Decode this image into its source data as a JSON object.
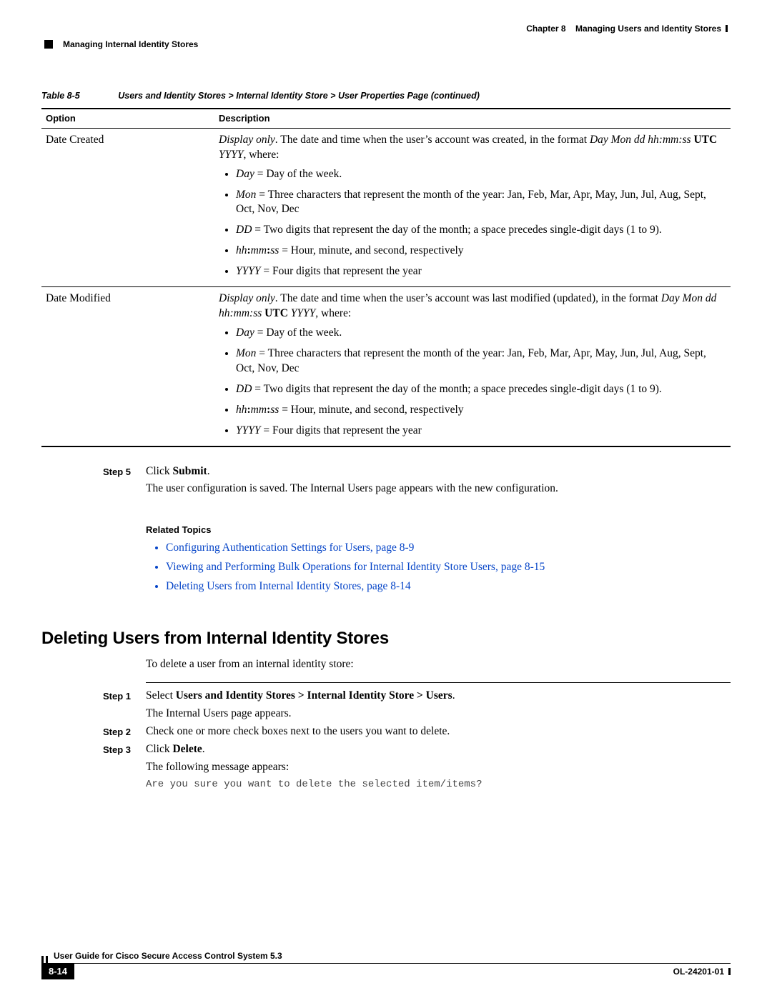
{
  "header": {
    "chapter_label": "Chapter 8",
    "chapter_title": "Managing Users and Identity Stores",
    "section_title": "Managing Internal Identity Stores"
  },
  "table": {
    "label": "Table 8-5",
    "title": "Users and Identity Stores > Internal Identity Store > User Properties Page  (continued)",
    "columns": {
      "option": "Option",
      "description": "Description"
    },
    "rows": [
      {
        "option": "Date Created",
        "intro_prefix": "Display only",
        "intro_mid": ". The date and time when the user’s account was created, in the format ",
        "intro_fmt": "Day Mon dd hh:mm:ss",
        "intro_b": " UTC ",
        "intro_yy": "YYYY",
        "intro_suffix": ", where:",
        "bullets": [
          {
            "lead_i": "Day",
            "rest": " = Day of the week."
          },
          {
            "lead_i": "Mon",
            "rest": " = Three characters that represent the month of the year: Jan, Feb, Mar, Apr, May, Jun, Jul, Aug, Sept, Oct, Nov, Dec"
          },
          {
            "lead_i": "DD",
            "rest": " = Two digits that represent the day of the month; a space precedes single-digit days (1 to 9)."
          },
          {
            "lead_i": "hh",
            "b1": ":",
            "mid_i": "mm",
            "b2": ":",
            "end_i": "ss",
            "rest": " = Hour, minute, and second, respectively"
          },
          {
            "lead_i": "YYYY",
            "rest": " = Four digits that represent the year"
          }
        ]
      },
      {
        "option": "Date Modified",
        "intro_prefix": "Display only",
        "intro_mid": ". The date and time when the user’s account was last modified (updated), in the format ",
        "intro_fmt": "Day Mon dd hh:mm:ss",
        "intro_b": " UTC ",
        "intro_yy": "YYYY",
        "intro_suffix": ", where:",
        "bullets": [
          {
            "lead_i": "Day",
            "rest": " = Day of the week."
          },
          {
            "lead_i": "Mon",
            "rest": " = Three characters that represent the month of the year: Jan, Feb, Mar, Apr, May, Jun, Jul, Aug, Sept, Oct, Nov, Dec"
          },
          {
            "lead_i": "DD",
            "rest": " = Two digits that represent the day of the month; a space precedes single-digit days (1 to 9)."
          },
          {
            "lead_i": "hh",
            "b1": ":",
            "mid_i": "mm",
            "b2": ":",
            "end_i": "ss",
            "rest": " = Hour, minute, and second, respectively"
          },
          {
            "lead_i": "YYYY",
            "rest": " = Four digits that represent the year"
          }
        ]
      }
    ]
  },
  "step5": {
    "label": "Step 5",
    "line1_a": "Click ",
    "line1_b": "Submit",
    "line1_c": ".",
    "line2": "The user configuration is saved. The Internal Users page appears with the new configuration."
  },
  "related": {
    "heading": "Related Topics",
    "links": [
      "Configuring Authentication Settings for Users, page 8-9",
      "Viewing and Performing Bulk Operations for Internal Identity Store Users, page 8-15",
      "Deleting Users from Internal Identity Stores, page 8-14"
    ]
  },
  "section2": {
    "title": "Deleting Users from Internal Identity Stores",
    "intro": "To delete a user from an internal identity store:",
    "steps": [
      {
        "label": "Step 1",
        "pre": "Select ",
        "bold": "Users and Identity Stores > Internal Identity Store > Users",
        "post": ".",
        "after": "The Internal Users page appears."
      },
      {
        "label": "Step 2",
        "pre": "Check one or more check boxes next to the users you want to delete.",
        "bold": "",
        "post": "",
        "after": ""
      },
      {
        "label": "Step 3",
        "pre": "Click ",
        "bold": "Delete",
        "post": ".",
        "after": "The following message appears:"
      }
    ],
    "code": "Are you sure you want to delete the selected item/items?"
  },
  "footer": {
    "title": "User Guide for Cisco Secure Access Control System 5.3",
    "page": "8-14",
    "docnum": "OL-24201-01"
  }
}
